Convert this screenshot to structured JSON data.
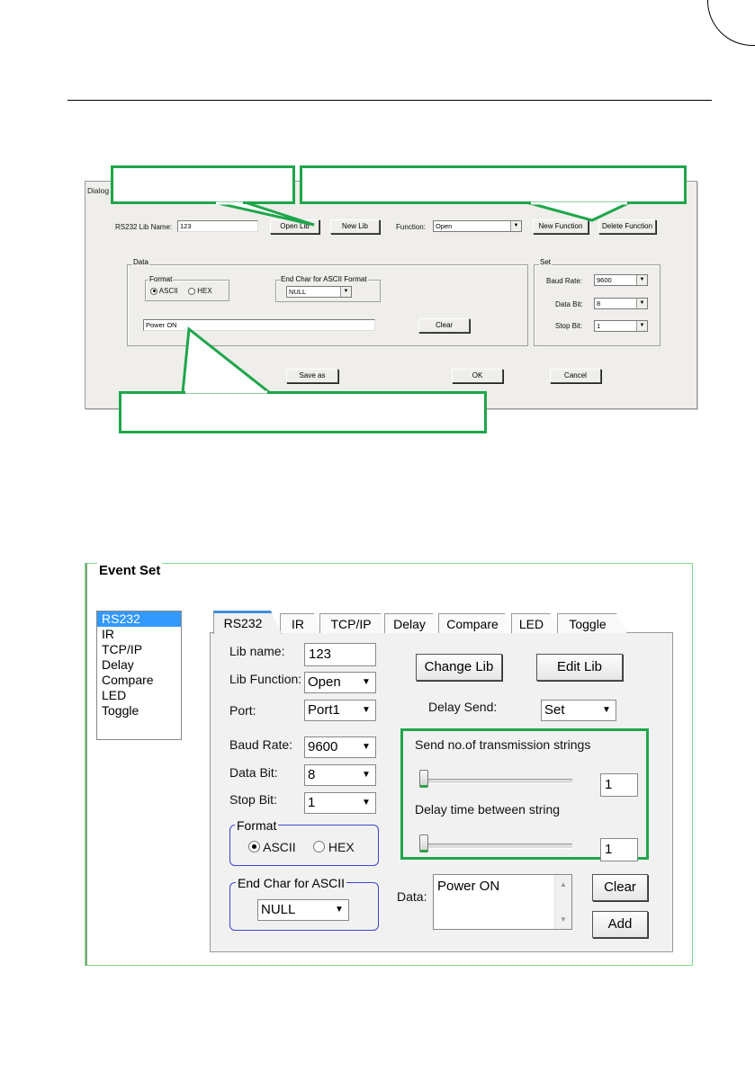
{
  "dialog": {
    "title": "Dialog",
    "lib_name_label": "RS232 Lib Name:",
    "lib_name_value": "123",
    "open_lib_label": "Open Lib",
    "new_lib_label": "New Lib",
    "function_label": "Function:",
    "function_value": "Open",
    "new_function_label": "New Function",
    "delete_function_label": "Delete Function",
    "data_group": "Data",
    "format_group": "Format",
    "ascii_label": "ASCII",
    "hex_label": "HEX",
    "end_char_group": "End Char for ASCII Format",
    "end_char_value": "NULL",
    "data_value": "Power ON",
    "clear_label": "Clear",
    "set_group": "Set",
    "baud_rate_label": "Baud Rate:",
    "baud_rate_value": "9600",
    "data_bit_label": "Data Bit:",
    "data_bit_value": "8",
    "stop_bit_label": "Stop Bit:",
    "stop_bit_value": "1",
    "save_as_label": "Save as",
    "ok_label": "OK",
    "cancel_label": "Cancel"
  },
  "event_set": {
    "title": "Event Set",
    "list_items": [
      "RS232",
      "IR",
      "TCP/IP",
      "Delay",
      "Compare",
      "LED",
      "Toggle"
    ],
    "selected_item": "RS232",
    "tabs": [
      "RS232",
      "IR",
      "TCP/IP",
      "Delay",
      "Compare",
      "LED",
      "Toggle"
    ],
    "active_tab": "RS232",
    "lib_name_label": "Lib name:",
    "lib_name_value": "123",
    "lib_function_label": "Lib Function:",
    "lib_function_value": "Open",
    "port_label": "Port:",
    "port_value": "Port1",
    "baud_rate_label": "Baud Rate:",
    "baud_rate_value": "9600",
    "data_bit_label": "Data Bit:",
    "data_bit_value": "8",
    "stop_bit_label": "Stop Bit:",
    "stop_bit_value": "1",
    "format_group": "Format",
    "ascii_label": "ASCII",
    "hex_label": "HEX",
    "end_char_group": "End Char for ASCII",
    "end_char_value": "NULL",
    "change_lib_label": "Change Lib",
    "edit_lib_label": "Edit Lib",
    "delay_send_label": "Delay Send:",
    "delay_send_value": "Set",
    "send_strings_label": "Send no.of transmission strings",
    "send_strings_value": "1",
    "delay_between_label": "Delay time between string",
    "delay_between_value": "1",
    "data_label": "Data:",
    "data_value": "Power ON",
    "clear_label": "Clear",
    "add_label": "Add"
  },
  "colors": {
    "callout_green": "#1ea64a",
    "group_blue": "#3b46d6",
    "tab_accent": "#3f8fd9",
    "list_select": "#3399ff"
  }
}
